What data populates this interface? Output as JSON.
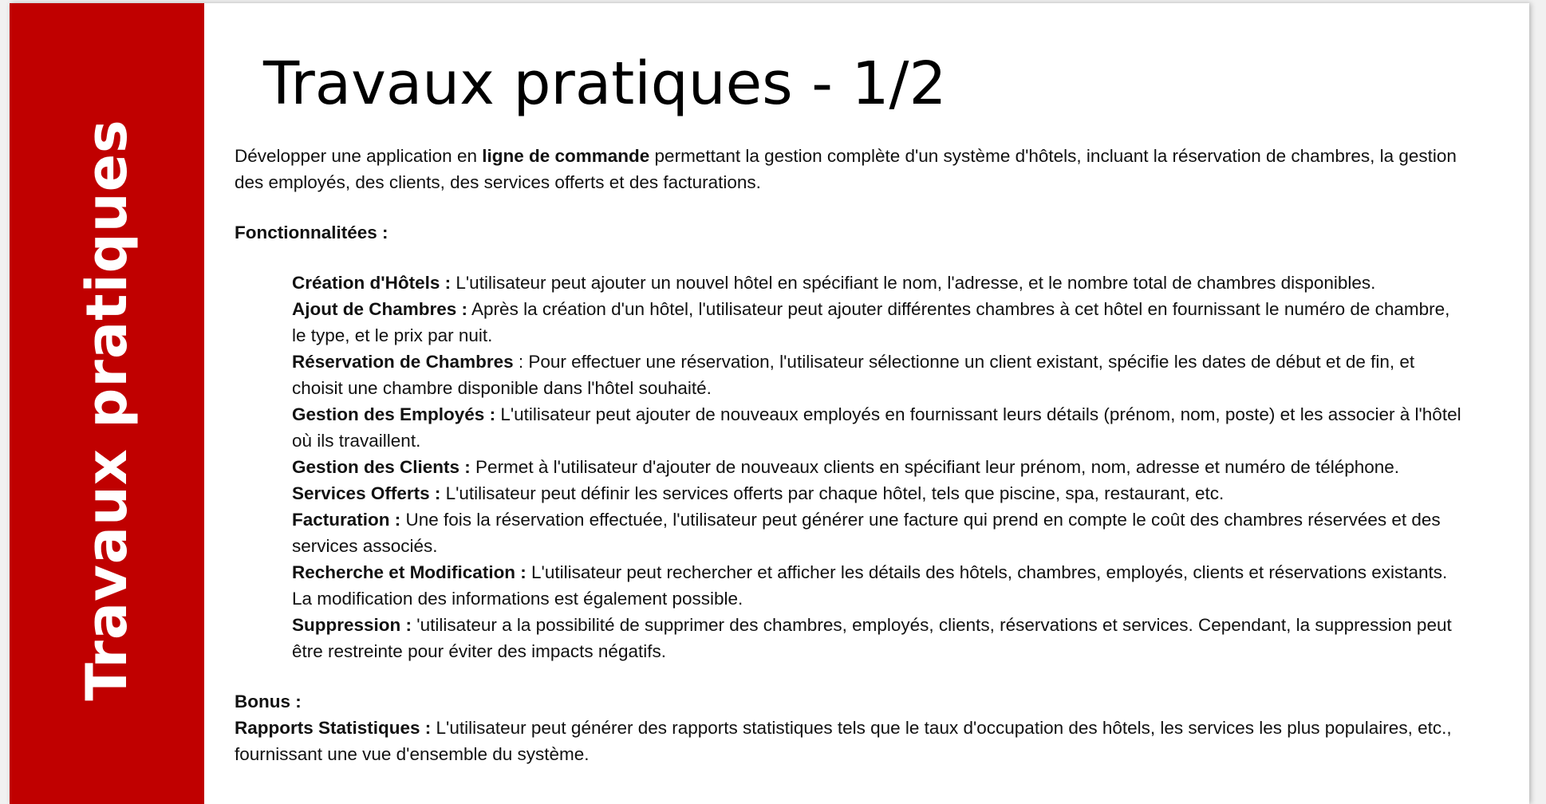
{
  "sidebar": {
    "title": "Travaux pratiques",
    "color": "#c00000"
  },
  "page_title": "Travaux pratiques - 1/2",
  "intro": {
    "before": "Développer une application en ",
    "bold": "ligne de commande",
    "after": " permettant la gestion complète d'un système d'hôtels, incluant la réservation de chambres, la gestion des employés, des clients, des services offerts et des facturations."
  },
  "features_heading": "Fonctionnalitées :",
  "features": [
    {
      "label": "Création d'Hôtels :",
      "text": " L'utilisateur peut ajouter un nouvel hôtel en spécifiant le nom, l'adresse, et le nombre total de chambres disponibles."
    },
    {
      "label": "Ajout de Chambres :",
      "text": " Après la création d'un hôtel, l'utilisateur peut ajouter différentes chambres à cet hôtel en fournissant le numéro de chambre, le type, et le prix par nuit."
    },
    {
      "label": "Réservation de Chambres",
      "text": " : Pour effectuer une réservation, l'utilisateur sélectionne un client existant, spécifie les dates de début et de fin, et choisit une chambre disponible dans l'hôtel souhaité."
    },
    {
      "label": "Gestion des Employés :",
      "text": " L'utilisateur peut ajouter de nouveaux employés en fournissant leurs détails (prénom, nom, poste) et les associer à l'hôtel où ils travaillent."
    },
    {
      "label": "Gestion des Clients :",
      "text": " Permet à l'utilisateur d'ajouter de nouveaux clients en spécifiant leur prénom, nom, adresse et numéro de téléphone."
    },
    {
      "label": "Services Offerts :",
      "text": " L'utilisateur peut définir les services offerts par chaque hôtel, tels que piscine, spa, restaurant, etc."
    },
    {
      "label": "Facturation :",
      "text": " Une fois la réservation effectuée, l'utilisateur peut générer une facture qui prend en compte le coût des chambres réservées et des services associés."
    },
    {
      "label": "Recherche et Modification :",
      "text": " L'utilisateur peut rechercher et afficher les détails des hôtels, chambres, employés, clients et réservations existants. La modification des informations est également possible."
    },
    {
      "label": "Suppression :",
      "text": " 'utilisateur a la possibilité de supprimer des chambres, employés, clients, réservations et services. Cependant, la suppression peut être restreinte pour éviter des impacts négatifs."
    }
  ],
  "bonus_heading": "Bonus :",
  "bonus": {
    "label": "Rapports Statistiques :",
    "text": " L'utilisateur peut générer des rapports statistiques tels que le taux d'occupation des hôtels, les services les plus populaires, etc., fournissant une vue d'ensemble du système."
  }
}
